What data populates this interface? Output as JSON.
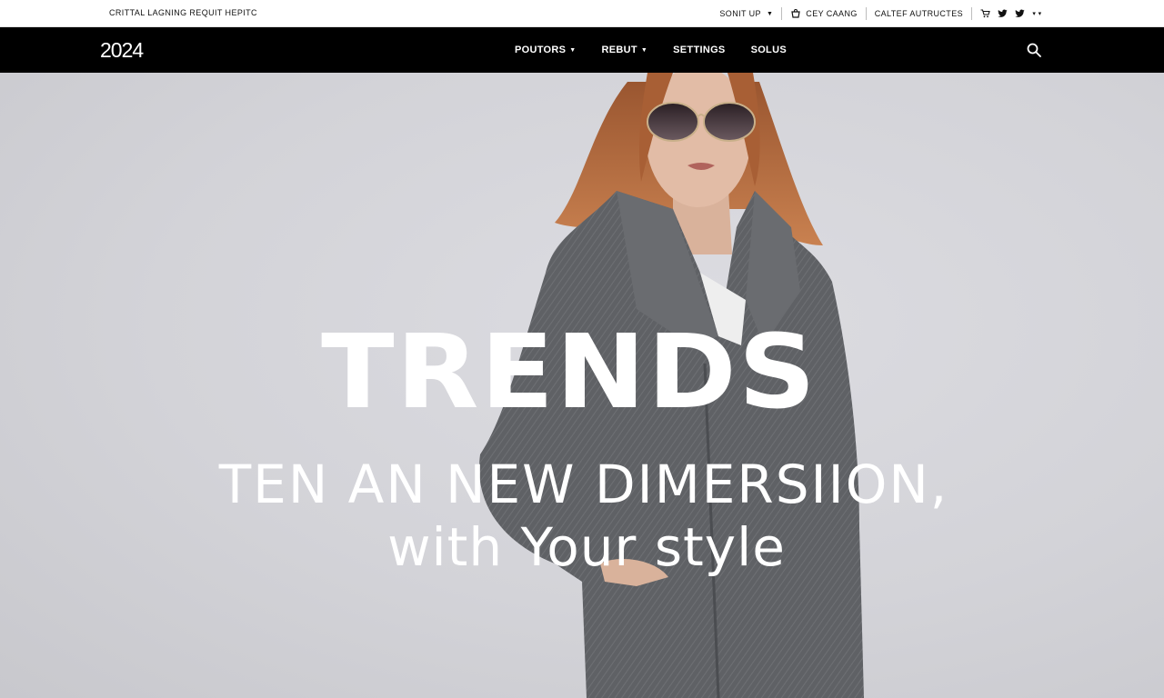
{
  "topbar": {
    "tagline": "CRITTAL LAGNING REQUIT HEPITC",
    "account_label": "SONIT UP",
    "cart_label": "CEY CAANG",
    "features_label": "CALTEF AUTRUCTES",
    "social_icons": [
      "cart-icon",
      "twitter-icon",
      "twitter-icon",
      "more-icon"
    ]
  },
  "nav": {
    "logo": "2024",
    "items": [
      {
        "label": "POUTORS",
        "has_dropdown": true
      },
      {
        "label": "REBUT",
        "has_dropdown": true
      },
      {
        "label": "SETTINGS",
        "has_dropdown": false
      },
      {
        "label": "SOLUS",
        "has_dropdown": false
      }
    ],
    "search_icon": "search-icon"
  },
  "hero": {
    "headline": "TRENDS",
    "subline_1": "TEN AN NEW DIMERSIION,",
    "subline_2": "with Your style"
  },
  "colors": {
    "nav_bg": "#000000",
    "topbar_bg": "#ffffff",
    "hero_bg": "#d4d4d9",
    "headline": "#ffffff",
    "coat": "#5e6064",
    "hair": "#b86a3a"
  }
}
